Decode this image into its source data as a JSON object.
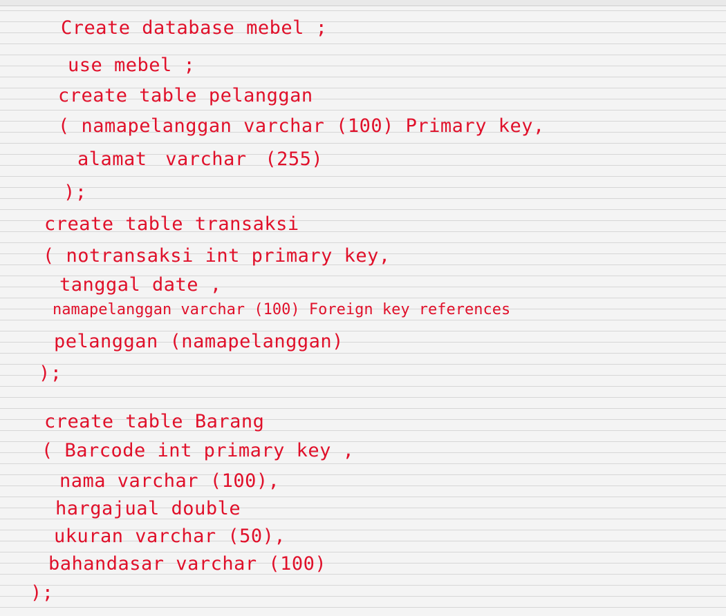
{
  "note": {
    "ink_color": "#e0102a",
    "paper_color": "#f4f4f4",
    "rule_color": "#d6d6d6",
    "lines": [
      "Create database mebel ;",
      "use mebel ;",
      "create table pelanggan",
      "( namapelanggan varchar (100) Primary key,",
      "alamat varchar (255)",
      ");",
      "create table transaksi",
      "( notransaksi int primary key,",
      "tanggal date ,",
      "namapelanggan varchar (100) Foreign key references",
      "pelanggan (namapelanggan)",
      ");",
      "create table Barang",
      "( Barcode int primary key ,",
      "nama varchar (100),",
      "hargajual double",
      "ukuran varchar (50),",
      "bahandasar varchar (100)",
      ");"
    ]
  }
}
